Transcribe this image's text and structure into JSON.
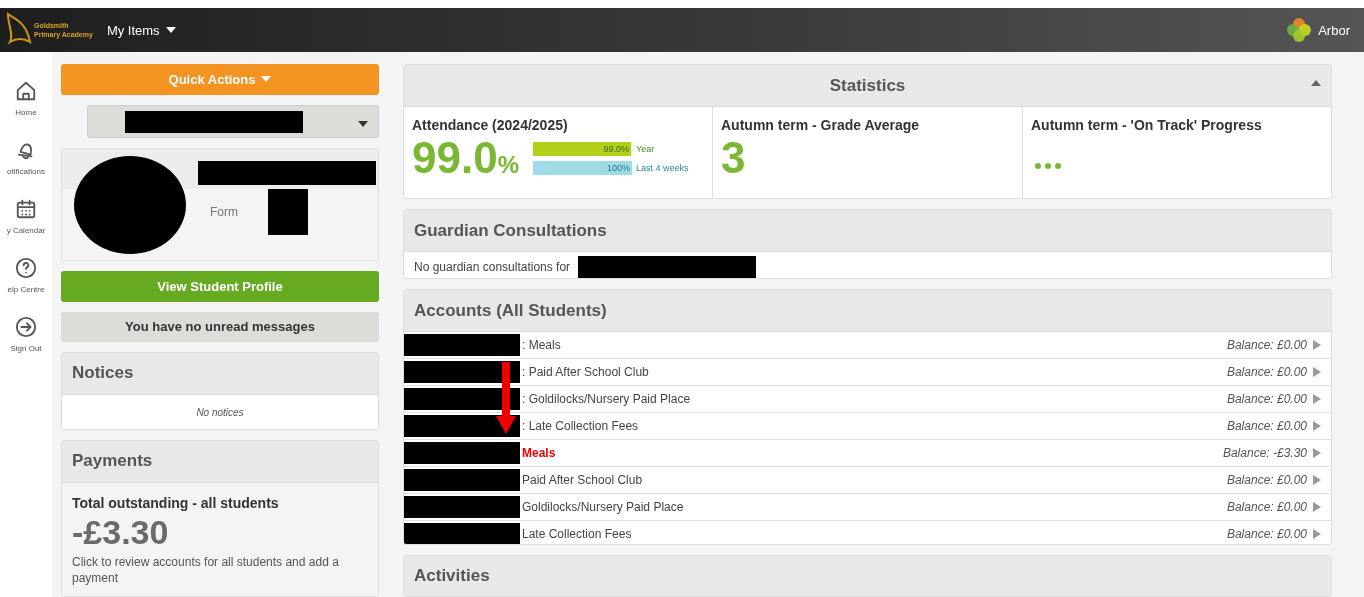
{
  "topbar": {
    "school": [
      "Goldsmith",
      "Primary Academy"
    ],
    "menu": "My Items",
    "brand": "Arbor"
  },
  "nav": [
    {
      "label": "Home"
    },
    {
      "label": "otifications"
    },
    {
      "label": "y Calendar"
    },
    {
      "label": "elp Centre"
    },
    {
      "label": "Sign Out"
    }
  ],
  "quick_actions": "Quick Actions",
  "student_select": {
    "redacted": true
  },
  "profile": {
    "name_redacted": true,
    "form_label": "Form",
    "form_redacted": true
  },
  "view_profile": "View Student Profile",
  "messages": "You have no unread messages",
  "notices": {
    "title": "Notices",
    "empty": "No notices"
  },
  "payments": {
    "title": "Payments",
    "subtitle": "Total outstanding - all students",
    "amount": "-£3.30",
    "hint": "Click to review accounts for all students and add a payment"
  },
  "statistics": {
    "title": "Statistics",
    "expanded": true,
    "attendance": {
      "title": "Attendance (2024/2025)",
      "value": "99.0",
      "unit": "%",
      "bars": [
        {
          "reading": "99.0%",
          "label": "Year",
          "level": 0.99,
          "color": "#b2cf1a"
        },
        {
          "reading": "100%",
          "label": "Last 4 weeks",
          "level": 1,
          "color": "#9fdbe6"
        }
      ]
    },
    "grade": {
      "title": "Autumn term - Grade Average",
      "value": "3"
    },
    "progress": {
      "title": "Autumn term - 'On Track' Progress",
      "loading": true
    }
  },
  "consultations": {
    "title": "Guardian Consultations",
    "text": "No guardian consultations for",
    "name_redacted": true
  },
  "accounts": {
    "title": "Accounts (All Students)",
    "annotation_arrow": true,
    "rows": [
      {
        "label": ": Meals",
        "balance": "Balance: £0.00",
        "owing": false
      },
      {
        "label": ": Paid After School Club",
        "balance": "Balance: £0.00",
        "owing": false
      },
      {
        "label": ": Goldilocks/Nursery Paid Place",
        "balance": "Balance: £0.00",
        "owing": false
      },
      {
        "label": ": Late Collection Fees",
        "balance": "Balance: £0.00",
        "owing": false
      },
      {
        "label": "Meals",
        "balance": "Balance: -£3.30",
        "owing": true
      },
      {
        "label": "Paid After School Club",
        "balance": "Balance: £0.00",
        "owing": false
      },
      {
        "label": "Goldilocks/Nursery Paid Place",
        "balance": "Balance: £0.00",
        "owing": false
      },
      {
        "label": "Late Collection Fees",
        "balance": "Balance: £0.00",
        "owing": false
      }
    ]
  },
  "activities": {
    "title": "Activities"
  }
}
